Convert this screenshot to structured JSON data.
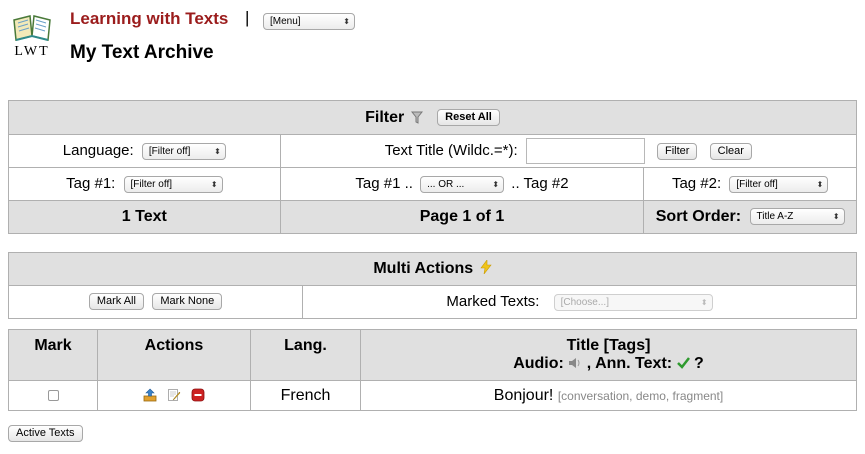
{
  "header": {
    "logo_text": "LWT",
    "app_title": "Learning with Texts",
    "separator": "|",
    "menu_select": "[Menu]",
    "page_title": "My Text Archive"
  },
  "filter": {
    "title": "Filter",
    "reset_all": "Reset All",
    "language_label": "Language:",
    "language_value": "[Filter off]",
    "text_title_label": "Text Title (Wildc.=*):",
    "text_title_value": "",
    "filter_button": "Filter",
    "clear_button": "Clear",
    "tag1_label": "Tag #1:",
    "tag1_value": "[Filter off]",
    "tag_op_prefix": "Tag #1 ..",
    "tag_op_value": "... OR ...",
    "tag_op_suffix": ".. Tag #2",
    "tag2_label": "Tag #2:",
    "tag2_value": "[Filter off]",
    "count": "1 Text",
    "page": "Page 1 of 1",
    "sort_label": "Sort Order:",
    "sort_value": "Title A-Z"
  },
  "multi": {
    "title": "Multi Actions",
    "mark_all": "Mark All",
    "mark_none": "Mark None",
    "marked_label": "Marked Texts:",
    "marked_value": "[Choose...]"
  },
  "list": {
    "headers": {
      "mark": "Mark",
      "actions": "Actions",
      "lang": "Lang.",
      "title_line1": "Title [Tags]",
      "title_line2_a": "Audio:",
      "title_line2_b": ", Ann. Text:",
      "title_line2_c": "?"
    },
    "rows": [
      {
        "lang": "French",
        "title": "Bonjour!",
        "tags": "[conversation, demo, fragment]"
      }
    ]
  },
  "footer": {
    "active_texts": "Active Texts"
  },
  "icons": {
    "filter": "funnel-icon",
    "multi": "lightning-icon",
    "audio": "speaker-icon",
    "ann": "check-icon",
    "unarchive": "unarchive-icon",
    "edit": "edit-icon",
    "delete": "delete-icon"
  },
  "colors": {
    "app_title": "#9b1c1c",
    "header_bg": "#e0e0e0",
    "check_green": "#2e9a2e",
    "delete_red": "#cc2222"
  }
}
